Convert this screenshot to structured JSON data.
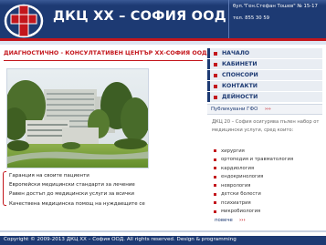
{
  "header": {
    "site_name": "ДКЦ ХХ – СОФИЯ ООД",
    "address": "бул.\"Ген.Стефан Тошев\" № 15-17",
    "phone": "тел. 855 30 59",
    "logo_icon": "medical-cross-logo"
  },
  "main": {
    "title": "ДИАГНОСТИЧНО - КОНСУЛТАТИВЕН ЦЕНТЪР ХХ-СОФИЯ ООД",
    "photo": "building-photo",
    "features": [
      "Гаранция на своите пациенти",
      "Европейски медицински стандарти за лечение",
      "Равен достъп до медицински услуги за всички",
      "Качествена медицинска помощ на нуждаещите се"
    ]
  },
  "nav": {
    "items": [
      {
        "label": "НАЧАЛО"
      },
      {
        "label": "КАБИНЕТИ"
      },
      {
        "label": "СПОНСОРИ"
      },
      {
        "label": "КОНТАКТИ"
      },
      {
        "label": "ДЕЙНОСТИ"
      }
    ]
  },
  "sidebar": {
    "published_label": "Публикувани ГФО",
    "published_arrow": "›››",
    "intro": "ДКЦ 20 – София осигурява пълен набор от медицински услуги, сред които:",
    "services": [
      "хирургия",
      "ортопедия и травматология",
      "кардиология",
      "ендокринология",
      "неврология",
      "детски болести",
      "психиатрия",
      "микробиология"
    ],
    "more_label": "повече",
    "more_arrow": "›››"
  },
  "footer": {
    "text": "Copyright © 2009-2013 ДКЦ ХХ – София ООД. All rights reserved. Design & programming"
  },
  "colors": {
    "brand_blue": "#1d3a73",
    "brand_red": "#c3161c"
  }
}
